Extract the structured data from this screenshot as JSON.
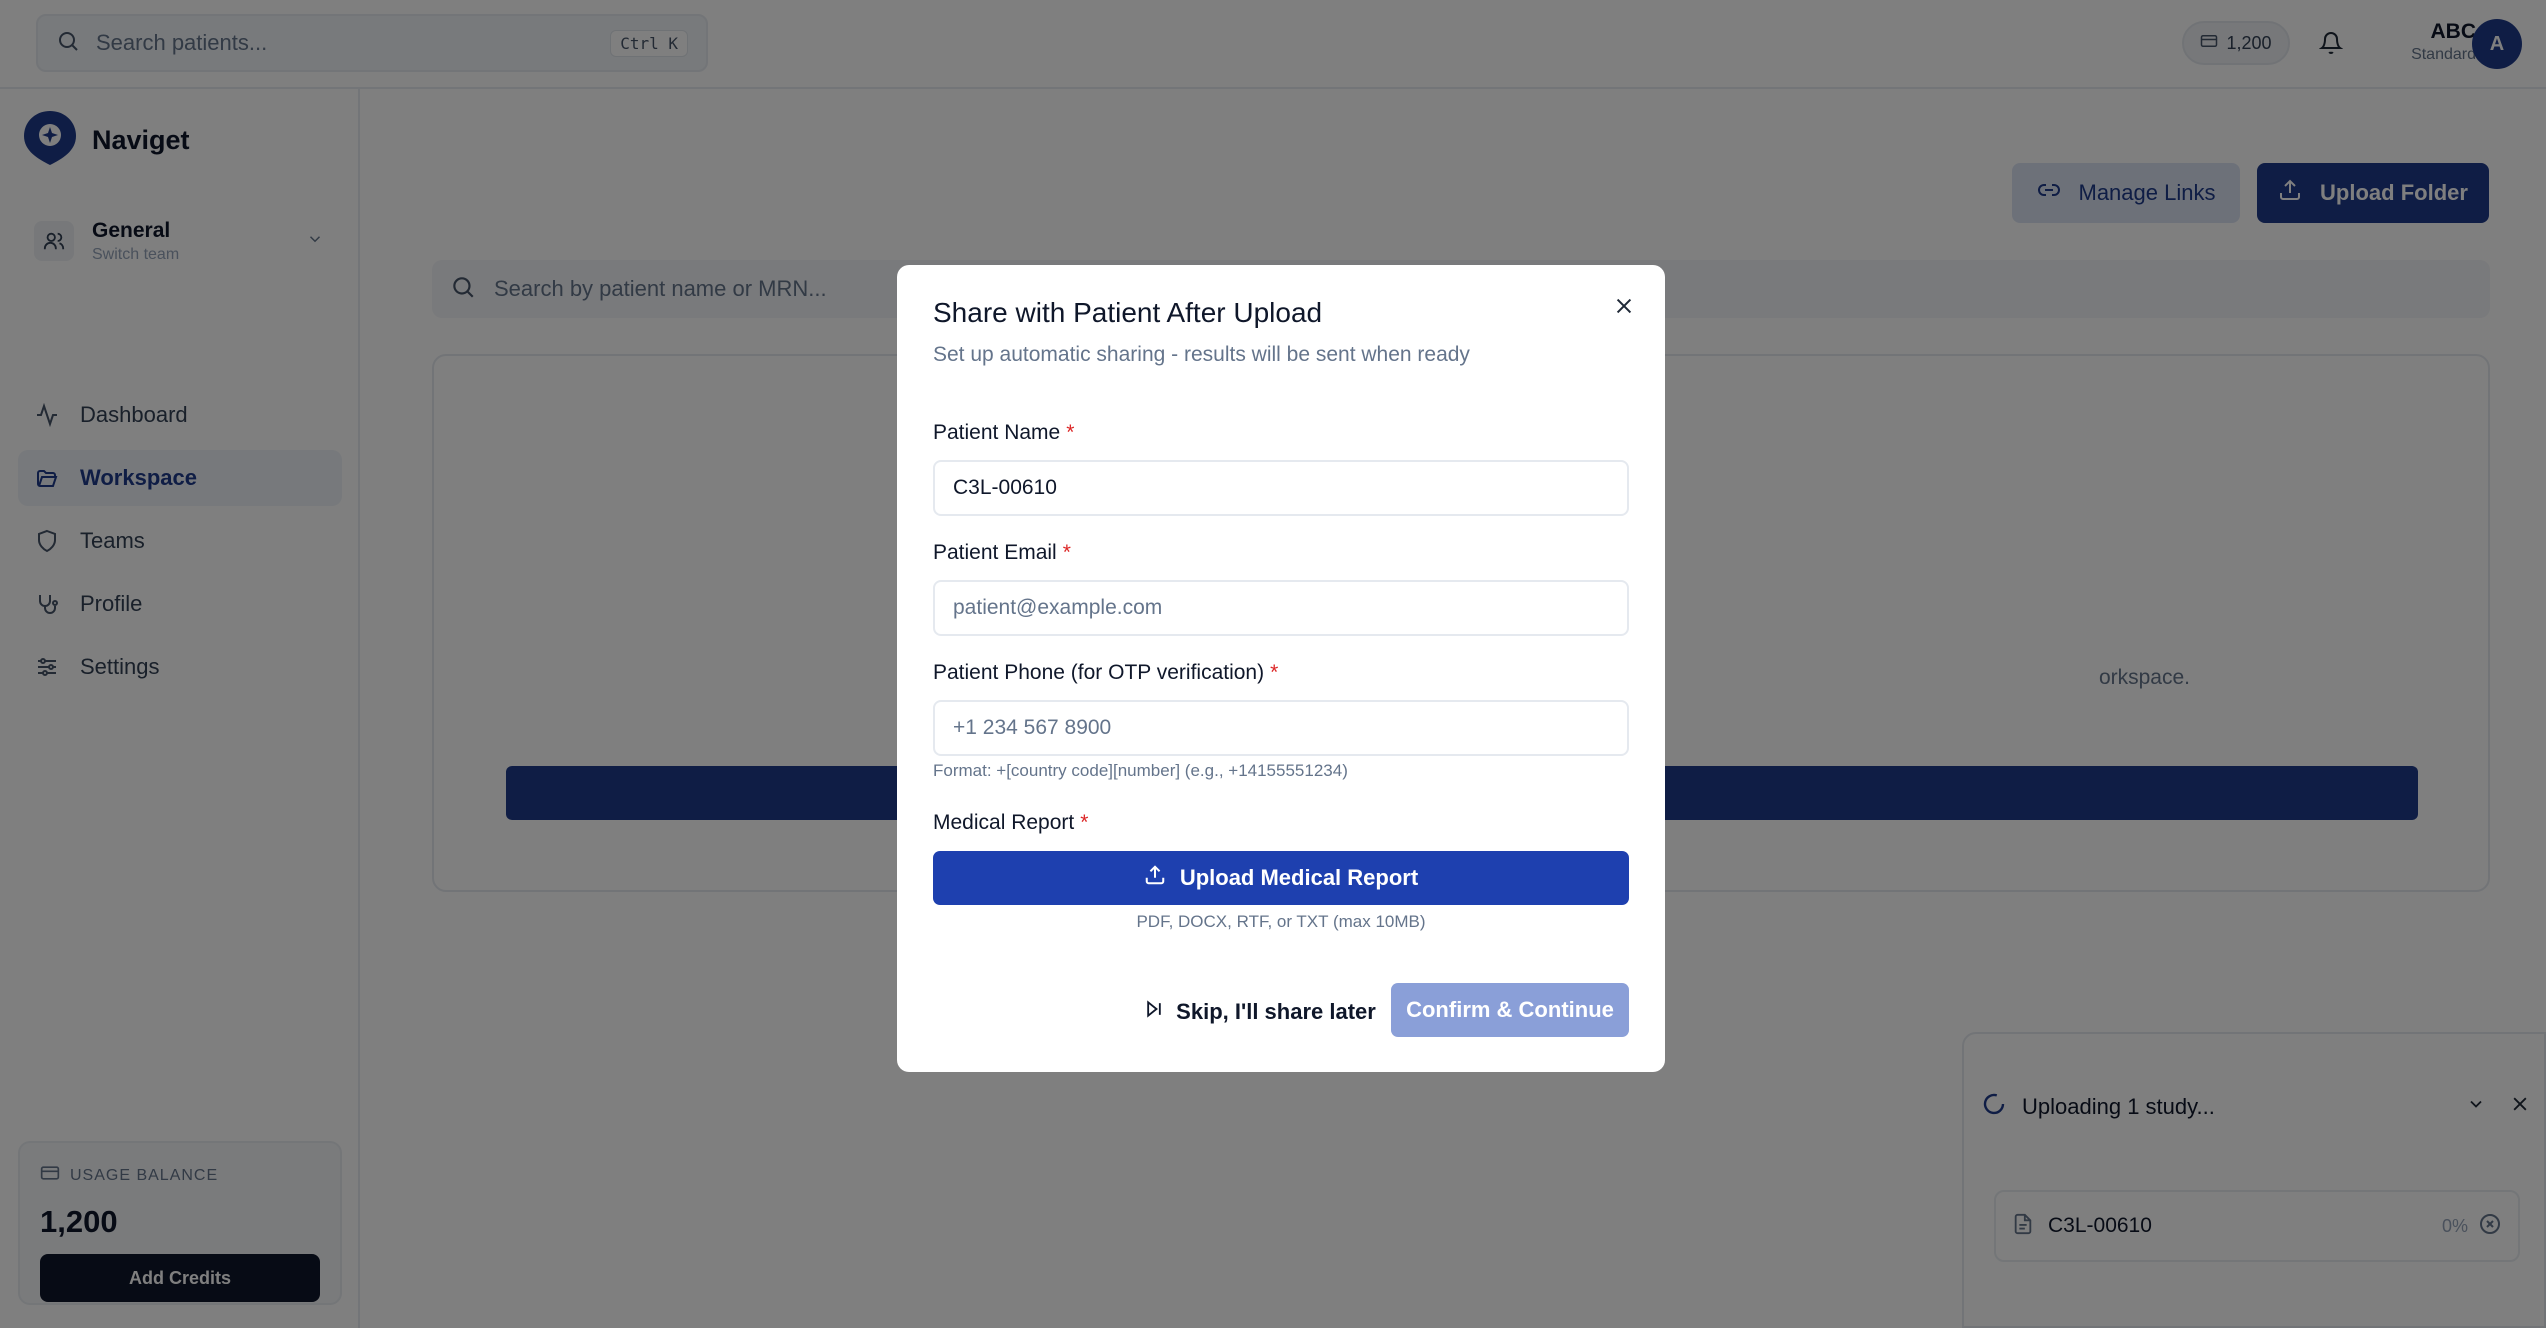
{
  "topbar": {
    "search_placeholder": "Search patients...",
    "search_shortcut": "Ctrl K",
    "credits": "1,200",
    "user_name": "ABC",
    "user_plan": "Standard",
    "avatar_initial": "A"
  },
  "sidebar": {
    "brand": "Naviget",
    "team_name": "General",
    "team_sub": "Switch team",
    "items": [
      {
        "label": "Dashboard",
        "icon": "activity-icon"
      },
      {
        "label": "Workspace",
        "icon": "folder-open-icon",
        "active": true
      },
      {
        "label": "Teams",
        "icon": "shield-icon"
      },
      {
        "label": "Profile",
        "icon": "stethoscope-icon"
      },
      {
        "label": "Settings",
        "icon": "sliders-icon"
      }
    ],
    "usage_title": "USAGE BALANCE",
    "usage_value": "1,200",
    "add_credits": "Add Credits"
  },
  "main": {
    "manage_links": "Manage Links",
    "upload_folder": "Upload Folder",
    "search_placeholder": "Search by patient name or MRN...",
    "workspace_text_visible": "orkspace."
  },
  "modal": {
    "title": "Share with Patient After Upload",
    "subtitle": "Set up automatic sharing - results will be sent when ready",
    "name_label": "Patient Name",
    "name_value": "C3L-00610",
    "email_label": "Patient Email",
    "email_placeholder": "patient@example.com",
    "phone_label": "Patient Phone (for OTP verification)",
    "phone_placeholder": "+1 234 567 8900",
    "phone_hint": "Format: +[country code][number] (e.g., +14155551234)",
    "report_label": "Medical Report",
    "report_button": "Upload Medical Report",
    "report_formats": "PDF, DOCX, RTF, or TXT (max 10MB)",
    "skip_button": "Skip, I'll share later",
    "confirm_button": "Confirm & Continue",
    "required_mark": "*"
  },
  "upload_panel": {
    "title": "Uploading 1 study...",
    "file_name": "C3L-00610",
    "progress": "0%"
  },
  "colors": {
    "primary": "#1e3a8a",
    "primary_button": "#1e40af",
    "confirm_disabled": "#8a9fd8",
    "required": "#dc2626",
    "dark_button": "#0f172a"
  }
}
